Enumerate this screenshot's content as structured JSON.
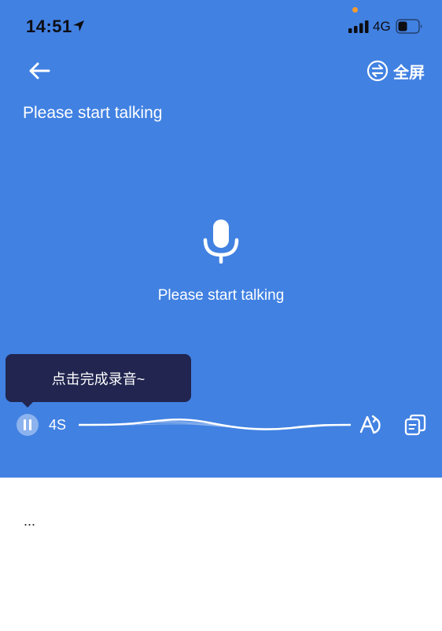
{
  "status_bar": {
    "time": "14:51",
    "network": "4G"
  },
  "header": {
    "fullscreen_label": "全屏"
  },
  "main": {
    "title": "Please start talking",
    "mic_caption": "Please start talking"
  },
  "tooltip": {
    "text": "点击完成录音~"
  },
  "recorder": {
    "duration": "4S"
  },
  "transcript": {
    "text": "..."
  },
  "colors": {
    "panel": "#4181e2",
    "tooltip": "#21254f",
    "accent_dot": "#f39c2f"
  }
}
